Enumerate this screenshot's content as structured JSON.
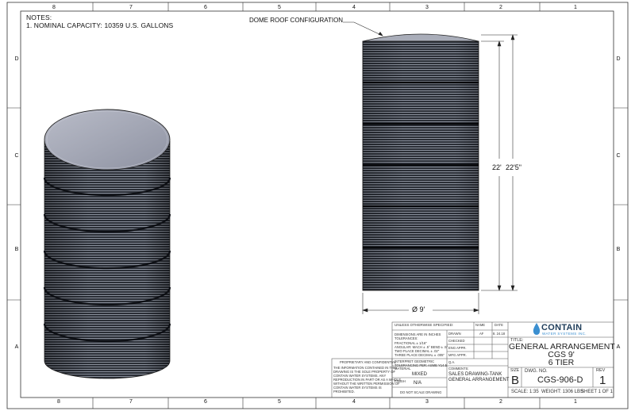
{
  "notes": {
    "heading": "NOTES:",
    "line1": "1. NOMINAL CAPACITY: 10359 U.S. GALLONS"
  },
  "zones": {
    "columns": [
      "8",
      "7",
      "6",
      "5",
      "4",
      "3",
      "2",
      "1"
    ],
    "rows": [
      "D",
      "C",
      "B",
      "A"
    ]
  },
  "callout": "DOME ROOF CONFIGURATION",
  "dimensions": {
    "height_tank": "22'",
    "height_overall": "22'5\"",
    "diameter": "Ø 9'"
  },
  "title_block": {
    "logo_name": "CONTAIN",
    "logo_sub": "WATER SYSTEMS INC.",
    "unless": "UNLESS OTHERWISE SPECIFIED:",
    "col_name": "NAME",
    "col_date": "DATE",
    "tol_lines": [
      "DIMENSIONS ARE IN INCHES",
      "TOLERANCES:",
      "FRACTIONAL ± 1/16\"",
      "ANGULAR: MACH ± .5° BEND ± .5°",
      "TWO PLACE DECIMAL   ± .02\"",
      "THREE PLACE DECIMAL  ± .005\""
    ],
    "gd": [
      "INTERPRET GEOMETRIC",
      "TOLERANCING PER: ASME Y14.5"
    ],
    "drawn_label": "DRAWN",
    "drawn_name": "AF",
    "drawn_date": "8. 24.18",
    "checked": "CHECKED",
    "eng_appr": "ENG APPR.",
    "mfg_appr": "MFG APPR.",
    "qa": "Q.A.",
    "comments": "COMMENTS:",
    "comment_lines": [
      "SALES DRAWING-TANK",
      "GENERAL ARRANGEMENT"
    ],
    "material_label": "MATERIAL",
    "material_value": "MIXED",
    "finish_label": "FINISH",
    "finish_value": "N/A",
    "no_scale": "DO NOT SCALE DRAWING",
    "proprietary_title": "PROPRIETARY AND CONFIDENTIAL",
    "proprietary_lines": [
      "THE INFORMATION CONTAINED IN THIS",
      "DRAWING IS THE SOLE PROPERTY OF",
      "CONTAIN WATER SYSTEMS.  ANY",
      "REPRODUCTION IN PART OR AS A WHOLE",
      "WITHOUT THE WRITTEN PERMISSION OF",
      "CONTAIN WATER SYSTEMS IS",
      "PROHIBITED."
    ],
    "title_label": "TITLE:",
    "title_lines": [
      "GENERAL ARRANGEMENT",
      "CGS 9'",
      "6 TIER"
    ],
    "size_label": "SIZE",
    "size_value": "B",
    "dwg_label": "DWG.  NO.",
    "dwg_value": "CGS-906-D",
    "rev_label": "REV",
    "rev_value": "1",
    "scale": "SCALE: 1:35",
    "weight": "WEIGHT: 1306 LBS",
    "sheet": "SHEET 1 OF 1"
  },
  "colors": {
    "line": "#222222",
    "tank_body": "#2b2f37",
    "tank_ridge": "#7b8290",
    "roof": "#a8abb8",
    "logo_blue": "#3b8fd0"
  }
}
